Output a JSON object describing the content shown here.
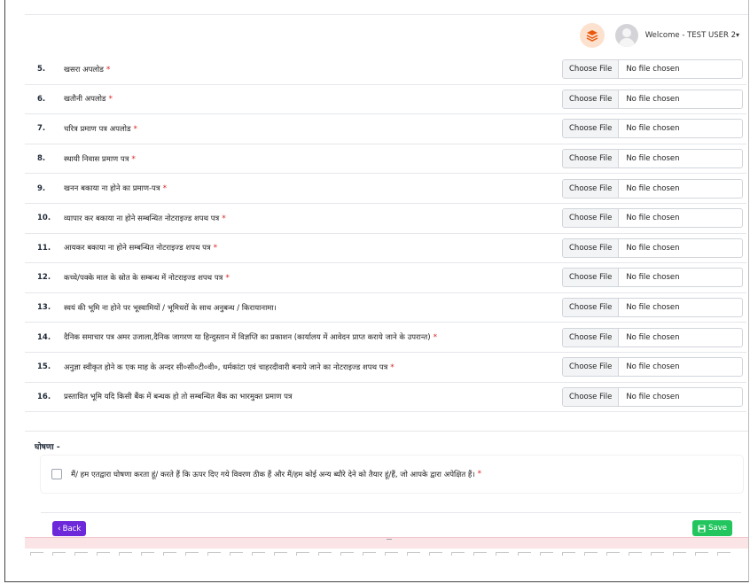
{
  "header": {
    "welcome_text": "Welcome - TEST USER 2",
    "dropdown_caret": "▾",
    "stack_icon": "layers-icon",
    "avatar_icon": "user-avatar-icon"
  },
  "file_input": {
    "choose_label": "Choose File",
    "no_file_label": "No file chosen"
  },
  "documents": [
    {
      "num": "5.",
      "label": "खसरा अपलोड",
      "required": true
    },
    {
      "num": "6.",
      "label": "खतौनी अपलोड",
      "required": true
    },
    {
      "num": "7.",
      "label": "चरित्र प्रमाण पत्र अपलोड",
      "required": true
    },
    {
      "num": "8.",
      "label": "स्थायी निवास प्रमाण पत्र",
      "required": true
    },
    {
      "num": "9.",
      "label": "खनन बकाया ना होने का प्रमाण-पत्र",
      "required": true
    },
    {
      "num": "10.",
      "label": "व्यापार कर बकाया ना होने सम्बन्धित नोटराइज्ड शपथ पत्र",
      "required": true
    },
    {
      "num": "11.",
      "label": "आयकर बकाया ना होने सम्बन्धित नोटराइज्ड शपथ पत्र",
      "required": true
    },
    {
      "num": "12.",
      "label": "कच्चे/पक्के माल के स्रोत के सम्बन्ध में नोटराइज्ड शपथ पत्र",
      "required": true
    },
    {
      "num": "13.",
      "label": "स्वयं की भूमि ना होने पर भूस्वामियों / भूमिधरों के साथ अनुबन्ध / किरायानामा।",
      "required": false
    },
    {
      "num": "14.",
      "label": "दैनिक समाचार पत्र अमर उजाला,दैनिक जागरण या हिन्दुस्तान में विज्ञप्ति का प्रकाशन (कार्यालय में आवेदन प्राप्त कराये जाने के उपरान्त)",
      "required": true
    },
    {
      "num": "15.",
      "label": "अनुज्ञा स्वीकृत होने क एक माह के अन्दर सी०सी०टी०वी०, धर्मकांटा एवं चाहरदीवारी बनाये जाने का नोटराइज्ड शपथ पत्र",
      "required": true
    },
    {
      "num": "16.",
      "label": "प्रस्तावित भूमि यदि किसी बैंक में बन्धक हो तो सम्बन्धित बैंक का भारमुक्त प्रमाण पत्र",
      "required": false
    }
  ],
  "declaration": {
    "title": "घोषणा -",
    "text": "मैं/ हम एतद्वारा घोषणा करता हूं/ करते हैं कि ऊपर दिए गये विवरण ठीक हैं और मैं/हम कोई अन्य ब्यौरे देने को तैयार हूं/हैं, जो आपके द्वारा अपेक्षित हैं।",
    "required_mark": "*",
    "checked": false
  },
  "actions": {
    "back_label": "Back",
    "back_icon": "chevron-left-icon",
    "save_label": "Save",
    "save_icon": "floppy-disk-icon"
  },
  "colors": {
    "required": "#dc2626",
    "back_button": "#6d28d9",
    "save_button": "#22c55e",
    "stack_bg": "#fde1cf",
    "stack_icon": "#ea580c"
  }
}
